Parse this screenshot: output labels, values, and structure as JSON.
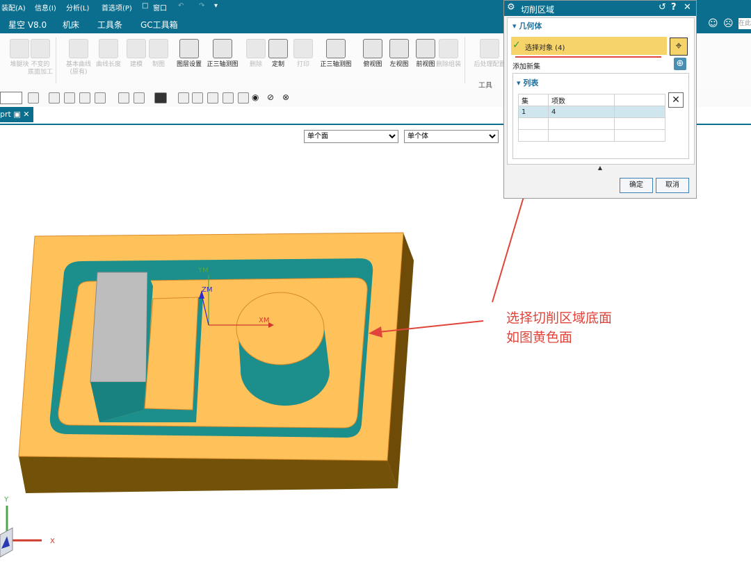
{
  "menubar": {
    "items": [
      "装配(A)",
      "信息(I)",
      "分析(L)",
      "首选项(P)",
      "窗口"
    ]
  },
  "tabs": [
    "星空 V8.0",
    "机床",
    "工具条",
    "GC工具箱"
  ],
  "ribbon": {
    "buttons": [
      {
        "label": "堆腿块",
        "enabled": false
      },
      {
        "label": "不变的\n底面加工",
        "enabled": false
      },
      {
        "label": "基本曲线\n(原有)",
        "enabled": false
      },
      {
        "label": "曲线长度",
        "enabled": false
      },
      {
        "label": "建模",
        "enabled": false
      },
      {
        "label": "制图",
        "enabled": false
      },
      {
        "label": "图层设置",
        "enabled": true
      },
      {
        "label": "正三轴测图",
        "enabled": true
      },
      {
        "label": "删除",
        "enabled": false
      },
      {
        "label": "定制",
        "enabled": true
      },
      {
        "label": "打印",
        "enabled": false
      },
      {
        "label": "正三轴测图",
        "enabled": true
      },
      {
        "label": "俯视图",
        "enabled": true
      },
      {
        "label": "左视图",
        "enabled": true
      },
      {
        "label": "前视图",
        "enabled": true
      },
      {
        "label": "删除组装",
        "enabled": false
      },
      {
        "label": "后处理配置",
        "enabled": false
      }
    ],
    "group_label": "工具"
  },
  "document_tab": "prt",
  "filters": {
    "face_filter": "单个面",
    "body_filter": "单个体"
  },
  "dialog": {
    "title": "切削区域",
    "geometry_section": "几何体",
    "select_object": "选择对象 (4)",
    "add_new_set": "添加新集",
    "list_section": "列表",
    "table": {
      "headers": [
        "集",
        "项数",
        ""
      ],
      "rows": [
        [
          "1",
          "4",
          ""
        ],
        [
          "",
          "",
          ""
        ],
        [
          "",
          "",
          ""
        ]
      ]
    },
    "ok": "确定",
    "cancel": "取消"
  },
  "annotation": {
    "line1": "选择切削区域底面",
    "line2": "如图黄色面"
  },
  "axes": {
    "ym": "YM",
    "zm": "ZM",
    "xm": "XM",
    "y": "Y",
    "x": "X"
  },
  "right_search_placeholder": "在此",
  "colors": {
    "titlebar": "#0b6e8e",
    "selected_face": "#ffc15a",
    "part_side": "#6e4c08",
    "wall": "#1c8f8c",
    "annotation": "#e0443a",
    "highlight_row": "#f7d46a"
  }
}
